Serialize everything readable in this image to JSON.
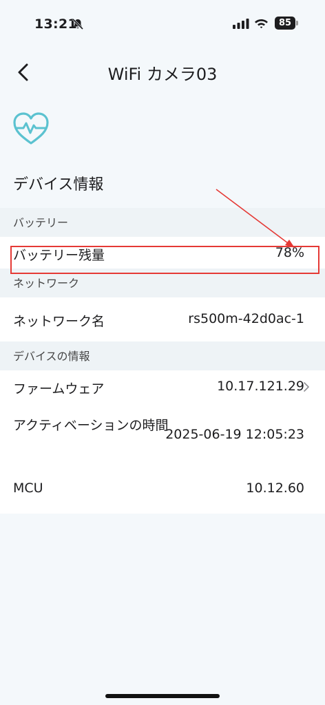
{
  "status": {
    "time": "13:21",
    "battery_level": "85"
  },
  "nav": {
    "title": "WiFi カメラ03"
  },
  "section": {
    "title": "デバイス情報"
  },
  "groups": [
    {
      "header": "バッテリー",
      "rows": [
        {
          "label": "バッテリー残量",
          "value": "78%"
        }
      ]
    },
    {
      "header": "ネットワーク",
      "rows": [
        {
          "label": "ネットワーク名",
          "value": "rs500m-42d0ac-1"
        }
      ]
    },
    {
      "header": "デバイスの情報",
      "rows": [
        {
          "label": "ファームウェア",
          "value": "10.17.121.29"
        },
        {
          "label": "アクティベーションの時間",
          "value": "2025-06-19 12:05:23"
        },
        {
          "label": "MCU",
          "value": "10.12.60"
        }
      ]
    }
  ],
  "colors": {
    "accent": "#5bc2d0",
    "highlight": "#e53935",
    "background": "#f4f8fb"
  },
  "icons": [
    "mute-icon",
    "signal-icon",
    "wifi-icon",
    "battery-icon",
    "back-chevron-icon",
    "heart-pulse-icon",
    "chevron-right-icon"
  ]
}
